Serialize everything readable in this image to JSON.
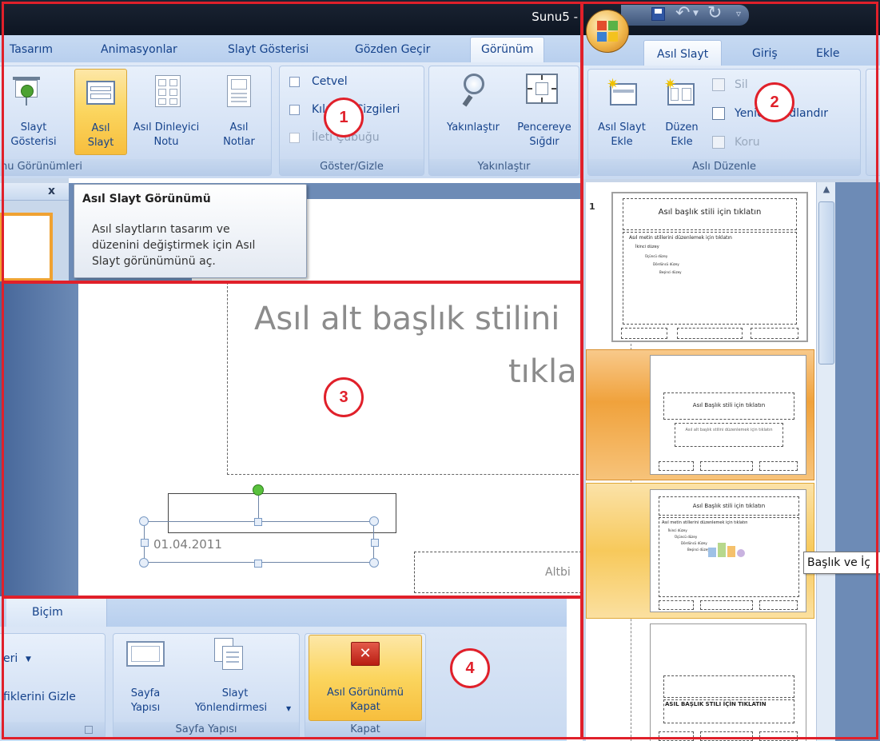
{
  "panel1": {
    "title": "Sunu5 -",
    "tabs": [
      "Tasarım",
      "Animasyonlar",
      "Slayt Gösterisi",
      "Gözden Geçir",
      "Görünüm"
    ],
    "buttons": {
      "slayt_gosterisi": [
        "Slayt",
        "Gösterisi"
      ],
      "asil_slayt": [
        "Asıl",
        "Slayt"
      ],
      "asil_dinleyici": [
        "Asıl Dinleyici",
        "Notu"
      ],
      "asil_notlar": [
        "Asıl",
        "Notlar"
      ],
      "yakinlastir": "Yakınlaştır",
      "pencereye_sigdir": [
        "Pencereye",
        "Sığdır"
      ]
    },
    "checkboxes": [
      "Cetvel",
      "Kılavuz Çizgileri",
      "İleti Çubuğu"
    ],
    "groups": {
      "gorunumler": "nu Görünümleri",
      "goster_gizle": "Göster/Gizle",
      "yakinlastir": "Yakınlaştır"
    },
    "close_symbol": "x",
    "tooltip": {
      "title": "Asıl Slayt Görünümü",
      "body": [
        "Asıl slaytların tasarım ve",
        "düzenini değiştirmek için Asıl",
        "Slayt görünümünü aç."
      ]
    }
  },
  "panel2": {
    "tabs": [
      "Asıl Slayt",
      "Giriş",
      "Ekle"
    ],
    "buttons": {
      "asil_slayt_ekle": [
        "Asıl Slayt",
        "Ekle"
      ],
      "duzen_ekle": [
        "Düzen",
        "Ekle"
      ],
      "sil": "Sil",
      "yeniden_adlandir": "Yeniden Adlandır",
      "koru": "Koru"
    },
    "group": "Aslı Düzenle",
    "slide_number": "1",
    "thumb1": {
      "title": "Asıl başlık stili için tıklatın",
      "lines": [
        "Asıl metin stillerini düzenlemek için tıklatın",
        "İkinci düzey",
        "Üçüncü düzey",
        "Dördüncü düzey",
        "Beşinci düzey"
      ]
    },
    "thumb2": {
      "title": "Asıl Başlık stili için tıklatın",
      "sub": "Asıl alt başlık stilini düzenlemek için tıklatın"
    },
    "thumb3": {
      "title": "Asıl Başlık stili için tıklatın",
      "lines": [
        "Asıl metin stillerini düzenlemek için tıklatın",
        "İkinci düzey",
        "Üçüncü düzey",
        "Dördüncü düzey",
        "Beşinci düzey"
      ]
    },
    "thumb4": {
      "title": "ASIL BAŞLIK STILI İÇİN TIKLATIN"
    },
    "hover_tip": "Başlık ve İç"
  },
  "panel3": {
    "subtitle_line1": "Asıl alt başlık stilini",
    "subtitle_line2": "tıkla",
    "date": "01.04.2011",
    "footer_partial": "Altbi"
  },
  "panel4": {
    "tab": "Biçim",
    "left_item1": "eri",
    "left_item2": "fiklerini Gizle",
    "buttons": {
      "sayfa_yapisi": [
        "Sayfa",
        "Yapısı"
      ],
      "slayt_yonlendirmesi": [
        "Slayt",
        "Yönlendirmesi"
      ],
      "kapat": [
        "Asıl Görünümü",
        "Kapat"
      ]
    },
    "groups": {
      "sayfa_yapisi": "Sayfa Yapısı",
      "kapat": "Kapat"
    }
  },
  "badges": [
    "1",
    "2",
    "3",
    "4"
  ],
  "colors": {
    "accent_red": "#e0202a",
    "ribbon_text": "#15428b",
    "highlight": "#fbd55e"
  }
}
